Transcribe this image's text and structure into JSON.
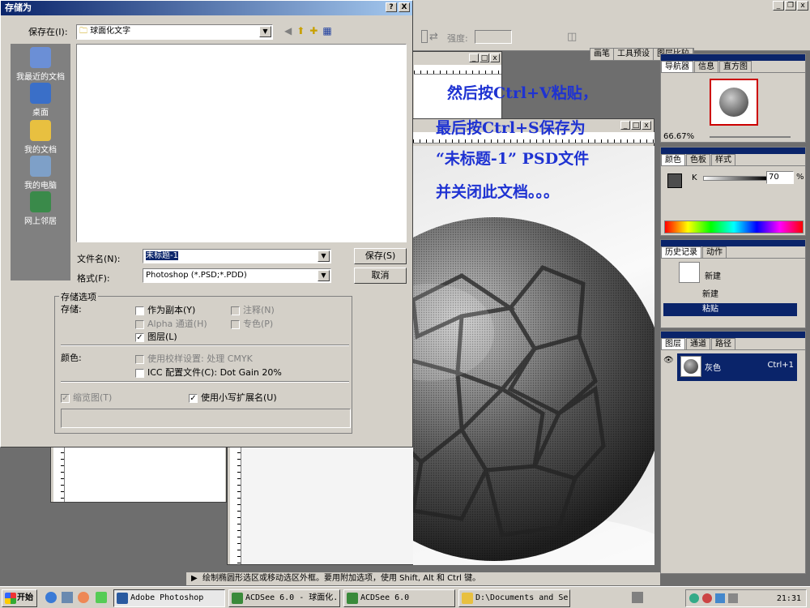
{
  "photoshop": {
    "opacity_label": "强度:",
    "palette_well_tabs": [
      "画笔",
      "工具预设",
      "图层比较"
    ]
  },
  "overlay": {
    "lines": [
      "然后按Ctrl+V粘贴，",
      "最后按Ctrl+S保存为",
      "“未标题-1” PSD文件",
      "并关闭此文档。。。"
    ],
    "color": "#1e32d2"
  },
  "navigator": {
    "tabs": [
      "导航器",
      "信息",
      "直方图"
    ],
    "zoom": "66.67%"
  },
  "color_panel": {
    "tabs": [
      "颜色",
      "色板",
      "样式"
    ],
    "channel": "K",
    "value": "70",
    "unit": "%"
  },
  "history": {
    "tabs": [
      "历史记录",
      "动作"
    ],
    "snapshot": "新建",
    "items": [
      "新建",
      "粘贴"
    ]
  },
  "layers": {
    "tabs": [
      "图层",
      "通道",
      "路径"
    ],
    "layer_name": "灰色",
    "shortcut": "Ctrl+1"
  },
  "status_bar": {
    "text": "绘制椭圆形选区或移动选区外框。要用附加选项，使用 Shift, Alt 和 Ctrl 键。"
  },
  "dialog": {
    "title": "存储为",
    "help_btn": "?",
    "close_btn": "X",
    "save_in_label": "保存在(I):",
    "save_in_value": "球面化文字",
    "places": [
      "我最近的文档",
      "桌面",
      "我的文档",
      "我的电脑",
      "网上邻居"
    ],
    "filename_label": "文件名(N):",
    "filename_value": "未标题-1",
    "format_label": "格式(F):",
    "format_value": "Photoshop (*.PSD;*.PDD)",
    "save_button": "保存(S)",
    "cancel_button": "取消",
    "options_group": "存储选项",
    "save_label": "存储:",
    "as_copy": "作为副本(Y)",
    "annotations": "注释(N)",
    "alpha": "Alpha 通道(H)",
    "spot": "专色(P)",
    "layers_opt": "图层(L)",
    "color_label": "颜色:",
    "proof": "使用校样设置: 处理 CMYK",
    "icc": "ICC 配置文件(C): Dot Gain 20%",
    "thumbnail": "缩览图(T)",
    "lowercase": "使用小写扩展名(U)"
  },
  "taskbar": {
    "start": "开始",
    "tasks": [
      "Adobe Photoshop",
      "ACDSee 6.0 - 球面化...",
      "ACDSee 6.0",
      "D:\\Documents and Se..."
    ],
    "clock": "21:31"
  }
}
